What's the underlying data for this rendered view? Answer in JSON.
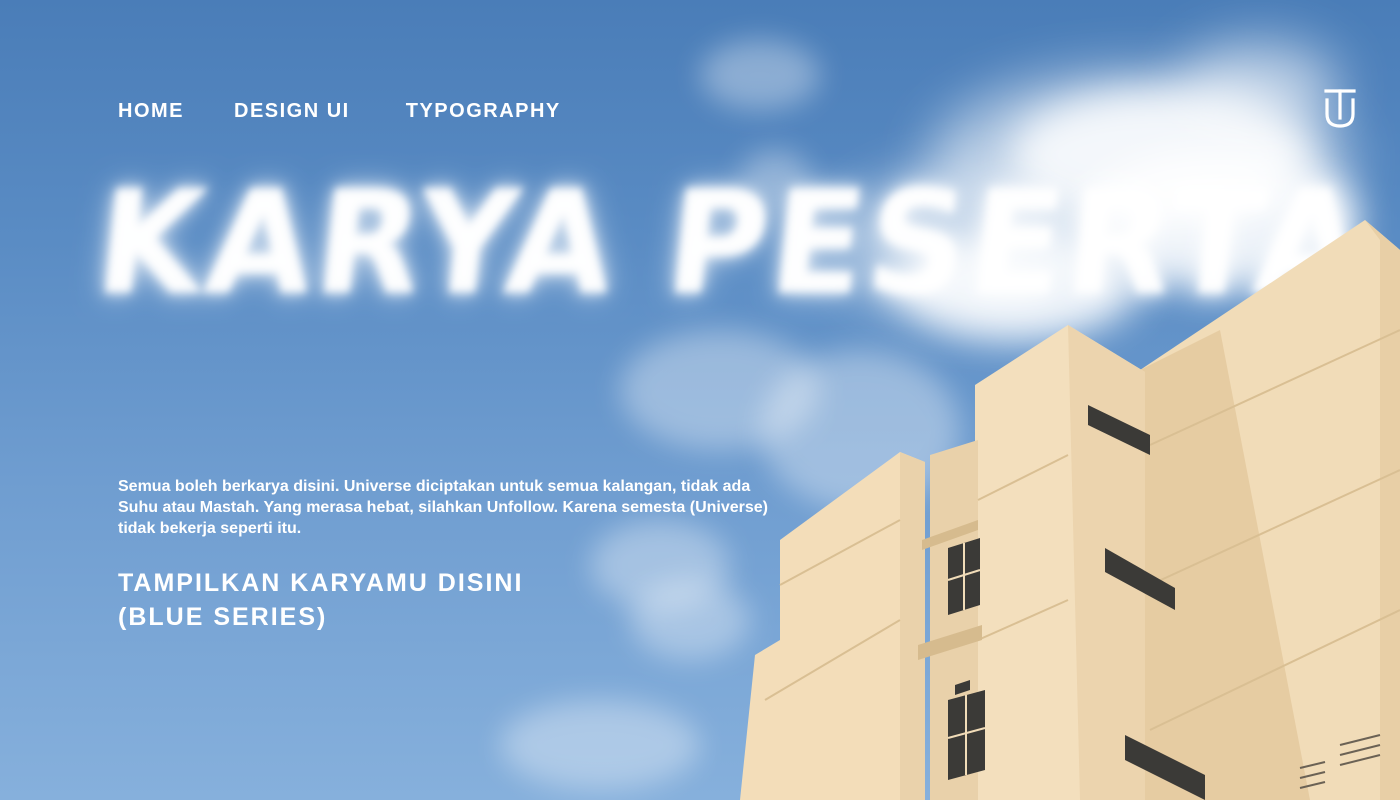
{
  "nav": {
    "items": [
      {
        "label": "HOME"
      },
      {
        "label": "DESIGN UI"
      },
      {
        "label": "TYPOGRAPHY"
      }
    ]
  },
  "logo": {
    "icon": "tu-monogram-icon"
  },
  "hero": {
    "headline": "KARYA PESERTA",
    "description": "Semua boleh berkarya disini. Universe diciptakan untuk semua kalangan, tidak ada Suhu atau Mastah. Yang merasa hebat, silahkan Unfollow. Karena semesta (Universe) tidak bekerja seperti itu.",
    "cta_line1": "TAMPILKAN KARYAMU DISINI",
    "cta_line2": "(BLUE SERIES)"
  },
  "colors": {
    "sky": "#5a8cc4",
    "text": "#ffffff",
    "building": "#f1dcb8"
  }
}
